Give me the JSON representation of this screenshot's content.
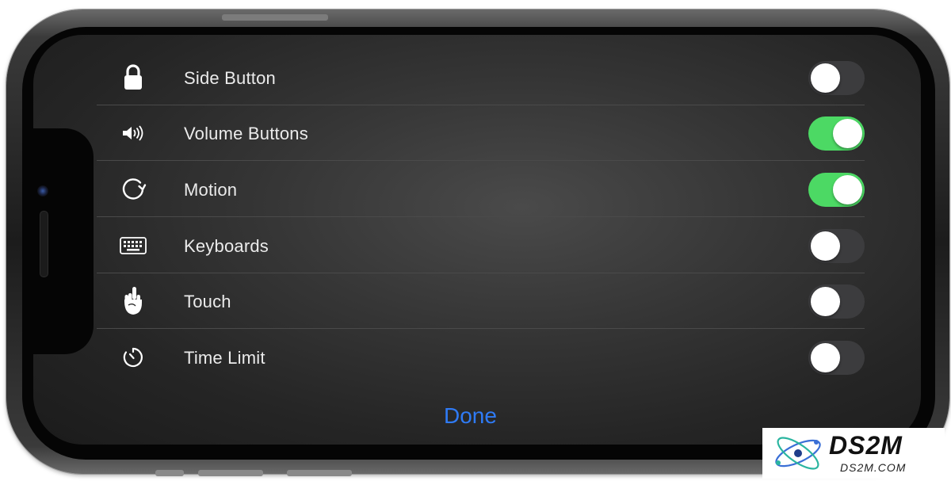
{
  "rows": [
    {
      "label": "Side Button",
      "icon": "lock-icon",
      "on": false
    },
    {
      "label": "Volume Buttons",
      "icon": "speaker-volume-icon",
      "on": true
    },
    {
      "label": "Motion",
      "icon": "rotate-icon",
      "on": true
    },
    {
      "label": "Keyboards",
      "icon": "keyboard-icon",
      "on": false
    },
    {
      "label": "Touch",
      "icon": "hand-touch-icon",
      "on": false
    },
    {
      "label": "Time Limit",
      "icon": "timer-icon",
      "on": false
    }
  ],
  "done_label": "Done",
  "watermark": {
    "main": "DS2M",
    "sub": "DS2M.COM"
  },
  "colors": {
    "toggle_on": "#4cd964",
    "toggle_off": "#3c3c3e",
    "done": "#2f7bf6"
  }
}
